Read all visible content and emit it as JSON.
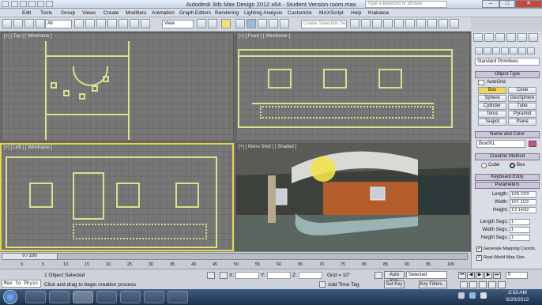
{
  "titlebar": {
    "title": "Autodesk 3ds Max Design 2012 x64  -  Student Version    room.max",
    "search_placeholder": "Type a keyword or phrase",
    "min": "–",
    "max": "□",
    "close": "✕"
  },
  "menu": [
    "Edit",
    "Tools",
    "Group",
    "Views",
    "Create",
    "Modifiers",
    "Animation",
    "Graph Editors",
    "Rendering",
    "Lighting Analysis",
    "Customize",
    "MAXScript",
    "Help",
    "Krakatoa"
  ],
  "toolbar": {
    "filter": "All",
    "refcoord": "View",
    "selset": "Create Selection Se"
  },
  "viewports": {
    "top": "[+] [ Top ] [ Wireframe ]",
    "front": "[+] [ Front ] [ Wireframe ]",
    "left": "[+] [ Left ] [ Wireframe ]",
    "persp": "[+] [ Mono Shot ] [ Shaded ]"
  },
  "panel": {
    "category": "Standard Primitives",
    "object_type": "Object Type",
    "autogrid": "AutoGrid",
    "buttons": [
      "Box",
      "Cone",
      "Sphere",
      "GeoSphere",
      "Cylinder",
      "Tube",
      "Torus",
      "Pyramid",
      "Teapot",
      "Plane"
    ],
    "name_color": "Name and Color",
    "name_value": "Box001",
    "creation_method": "Creation Method",
    "cube": "Cube",
    "box": "Box",
    "keyboard_entry": "Keyboard Entry",
    "parameters": "Parameters",
    "length_label": "Length:",
    "length": "10'8 22/3",
    "width_label": "Width:",
    "width": "16'1 11/3",
    "height_label": "Height:",
    "height": "1'2 14/32",
    "lsegs_label": "Length Segs:",
    "lsegs": "1",
    "wsegs_label": "Width Segs:",
    "wsegs": "1",
    "hsegs_label": "Height Segs:",
    "hsegs": "1",
    "gen_map": "Generate Mapping Coords.",
    "real_world": "Real-World Map Size"
  },
  "timeline": {
    "frame": "0 / 100",
    "ticks": [
      "0",
      "5",
      "10",
      "15",
      "20",
      "25",
      "30",
      "35",
      "40",
      "45",
      "50",
      "55",
      "60",
      "65",
      "70",
      "75",
      "80",
      "85",
      "90",
      "95",
      "100"
    ]
  },
  "status": {
    "maxscript": "Max to Physc",
    "selected": "1 Object Selected",
    "prompt": "Click and drag to begin creation process",
    "x_label": "X:",
    "y_label": "Y:",
    "z_label": "Z:",
    "grid": "Grid = 10\"",
    "add_time_tag": "Add Time Tag",
    "autokey": "Auto Key",
    "setkey": "Set Key",
    "selected_dd": "Selected",
    "key_filters": "Key Filters...",
    "frame_num": "0"
  },
  "tray": {
    "time": "2:33 AM",
    "date": "6/20/2012"
  }
}
